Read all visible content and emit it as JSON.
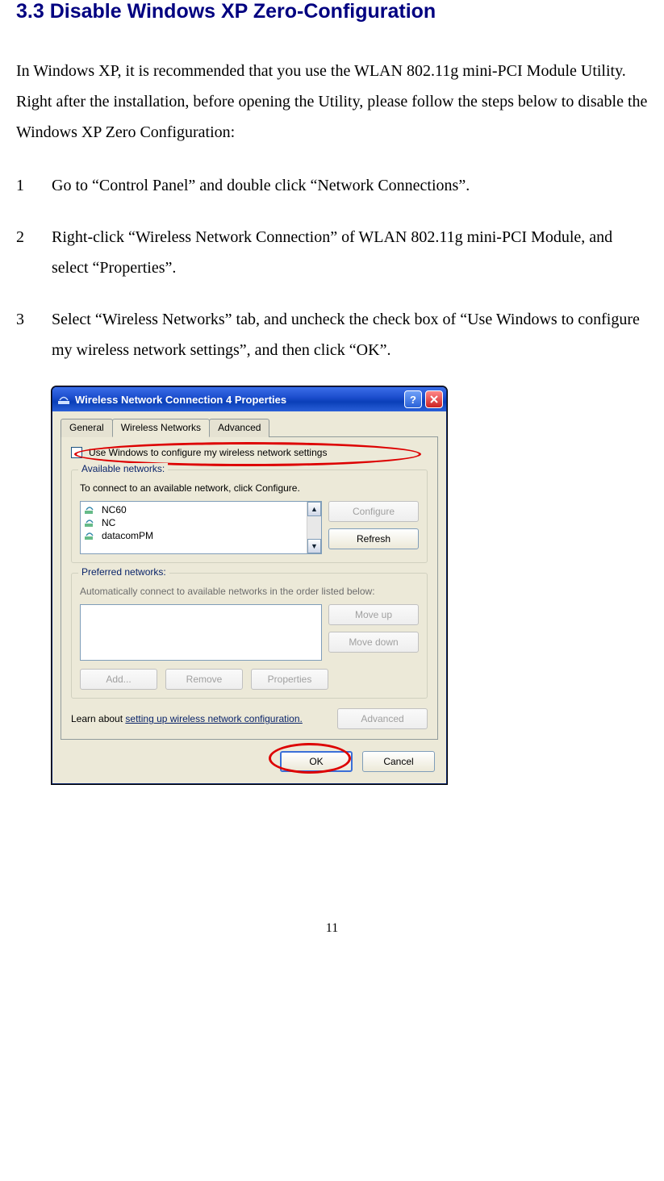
{
  "heading": "3.3 Disable Windows XP Zero-Configuration",
  "intro": "In Windows XP, it is recommended that you use the WLAN 802.11g mini-PCI Module Utility.  Right after the installation, before opening the Utility, please follow the steps below to disable the Windows XP Zero Configuration:",
  "steps": [
    {
      "num": "1",
      "text": "Go to “Control Panel” and double click “Network Connections”."
    },
    {
      "num": "2",
      "text": "Right-click “Wireless Network Connection” of WLAN 802.11g mini-PCI Module, and select “Properties”."
    },
    {
      "num": "3",
      "text": "Select “Wireless Networks” tab, and uncheck the check box of “Use Windows to configure my wireless network settings”, and then click “OK”."
    }
  ],
  "dialog": {
    "title": "Wireless Network Connection 4 Properties",
    "tabs": {
      "general": "General",
      "wireless": "Wireless Networks",
      "advanced": "Advanced",
      "active": "wireless"
    },
    "use_windows_label": "Use Windows to configure my wireless network settings",
    "available": {
      "legend": "Available networks:",
      "desc": "To connect to an available network, click Configure.",
      "items": [
        "NC60",
        "NC",
        "datacomPM"
      ],
      "configure": "Configure",
      "refresh": "Refresh"
    },
    "preferred": {
      "legend": "Preferred networks:",
      "desc": "Automatically connect to available networks in the order listed below:",
      "moveup": "Move up",
      "movedown": "Move down",
      "add": "Add...",
      "remove": "Remove",
      "properties": "Properties"
    },
    "learn_pre": "Learn about ",
    "learn_link": "setting up wireless network configuration.",
    "advanced_btn": "Advanced",
    "ok": "OK",
    "cancel": "Cancel"
  },
  "page_number": "11"
}
